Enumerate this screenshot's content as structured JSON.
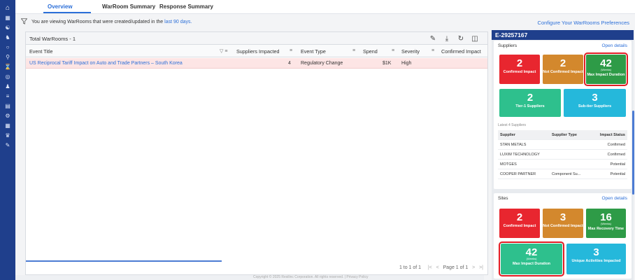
{
  "nav": {
    "icons": [
      "home-icon",
      "calendar-icon",
      "org-chart-icon",
      "users-group-icon",
      "network-icon",
      "mapping-icon",
      "hourglass-icon",
      "radar-icon",
      "person-icon",
      "list-icon",
      "grid-icon",
      "hierarchy-icon",
      "table-icon",
      "settings-flow-icon",
      "edit-doc-icon"
    ]
  },
  "tabs": [
    {
      "label": "Overview"
    },
    {
      "label": "WarRoom Summary"
    },
    {
      "label": "Response Summary"
    }
  ],
  "info": {
    "text": "You are viewing WarRooms that were created/updated in the ",
    "link": "last 90 days.",
    "configure": "Configure Your WarRooms Preferences"
  },
  "grid": {
    "total": "Total WarRooms - 1",
    "columns": [
      "Event Title",
      "Suppliers Impacted",
      "Event Type",
      "Spend",
      "Severity",
      "Confirmed Impact"
    ],
    "rows": [
      {
        "title": "US Reciprocal Tariff Impact on Auto and Trade Partners – South Korea",
        "suppliers": "4",
        "event_type": "Regulatory Change",
        "spend": "$1K",
        "severity": "High",
        "confirmed": ""
      }
    ],
    "pager": {
      "range": "1 to 1 of 1",
      "first": "|<",
      "prev": "<",
      "page": "Page 1 of 1",
      "next": ">",
      "last": ">|"
    }
  },
  "footer": {
    "text": "Copyright © 2025 Resilinc Corporation. All rights reserved. | Privacy Policy"
  },
  "panel": {
    "id": "E-29257167",
    "suppliers": {
      "title": "Suppliers",
      "link": "Open details",
      "tiles": [
        {
          "num": "2",
          "sub": "",
          "label": "Confirmed Impact"
        },
        {
          "num": "2",
          "sub": "",
          "label": "Not Confirmed Impact"
        },
        {
          "num": "42",
          "sub": "(Weeks)",
          "label": "Max Impact Duration"
        },
        {
          "num": "2",
          "sub": "",
          "label": "Tier-1 Suppliers"
        },
        {
          "num": "3",
          "sub": "",
          "label": "Sub-tier Suppliers"
        }
      ],
      "latest": "Latest 4 Suppliers",
      "headers": [
        "Supplier",
        "Supplier Type",
        "Impact Status"
      ],
      "rows": [
        {
          "name": "STAN METALS",
          "type": "",
          "status": "Confirmed"
        },
        {
          "name": "LUXIM TECHNOLOGY",
          "type": "",
          "status": "Confirmed"
        },
        {
          "name": "MOTGES",
          "type": "",
          "status": "Potential"
        },
        {
          "name": "COOPER PARTNER",
          "type": "Component Su...",
          "status": "Potential"
        }
      ]
    },
    "sites": {
      "title": "Sites",
      "link": "Open details",
      "tiles": [
        {
          "num": "2",
          "sub": "",
          "label": "Confirmed Impact"
        },
        {
          "num": "3",
          "sub": "",
          "label": "Not Confirmed Impact"
        },
        {
          "num": "16",
          "sub": "(Weeks)",
          "label": "Max Recovery Time"
        },
        {
          "num": "42",
          "sub": "(Weeks)",
          "label": "Max Impact Duration"
        },
        {
          "num": "3",
          "sub": "",
          "label": "Unique Activities Impacted"
        }
      ]
    }
  }
}
